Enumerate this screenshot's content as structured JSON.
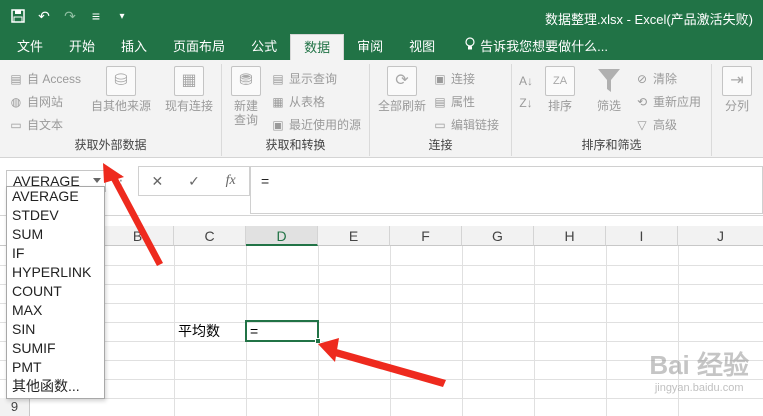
{
  "titlebar": {
    "title": "数据整理.xlsx - Excel(产品激活失败)",
    "quick_access": [
      {
        "name": "save-icon",
        "glyph": "💾"
      },
      {
        "name": "undo-icon",
        "glyph": "↶"
      },
      {
        "name": "redo-icon",
        "glyph": "↷"
      },
      {
        "name": "form-icon",
        "glyph": "≡"
      },
      {
        "name": "customize-icon",
        "glyph": "▾"
      }
    ],
    "accent": "#217346"
  },
  "ribbon_tabs": {
    "file": "文件",
    "home": "开始",
    "insert": "插入",
    "page_layout": "页面布局",
    "formulas": "公式",
    "data": "数据",
    "review": "审阅",
    "view": "视图",
    "tell_me": "告诉我您想要做什么..."
  },
  "ribbon": {
    "external": {
      "access": "自 Access",
      "web": "自网站",
      "text": "自文本",
      "other_sources": "自其他来源",
      "existing": "现有连接",
      "label": "获取外部数据"
    },
    "transform": {
      "new_query_1": "新建",
      "new_query_2": "查询",
      "show_queries": "显示查询",
      "from_table": "从表格",
      "recent_sources": "最近使用的源",
      "label": "获取和转换"
    },
    "connections": {
      "refresh_all": "全部刷新",
      "connections": "连接",
      "properties": "属性",
      "edit_links": "编辑链接",
      "label": "连接"
    },
    "sort_filter": {
      "sort": "排序",
      "filter": "筛选",
      "clear": "清除",
      "reapply": "重新应用",
      "advanced": "高级",
      "label": "排序和筛选"
    },
    "tools": {
      "text_to_columns": "分列"
    }
  },
  "formula_bar": {
    "name_box": "AVERAGE",
    "cancel": "✕",
    "enter": "✓",
    "fx": "fx",
    "content": "="
  },
  "function_list": [
    "AVERAGE",
    "STDEV",
    "SUM",
    "IF",
    "HYPERLINK",
    "COUNT",
    "MAX",
    "SIN",
    "SUMIF",
    "PMT",
    "其他函数..."
  ],
  "grid": {
    "columns": [
      "B",
      "C",
      "D",
      "E",
      "F",
      "G",
      "H",
      "I",
      "J"
    ],
    "selected_column": "D",
    "last_row_number": "9",
    "cells": {
      "label": "平均数",
      "active_value": "="
    }
  },
  "watermark": {
    "logo": "Bai 经验",
    "sub": "jingyan.baidu.com"
  }
}
